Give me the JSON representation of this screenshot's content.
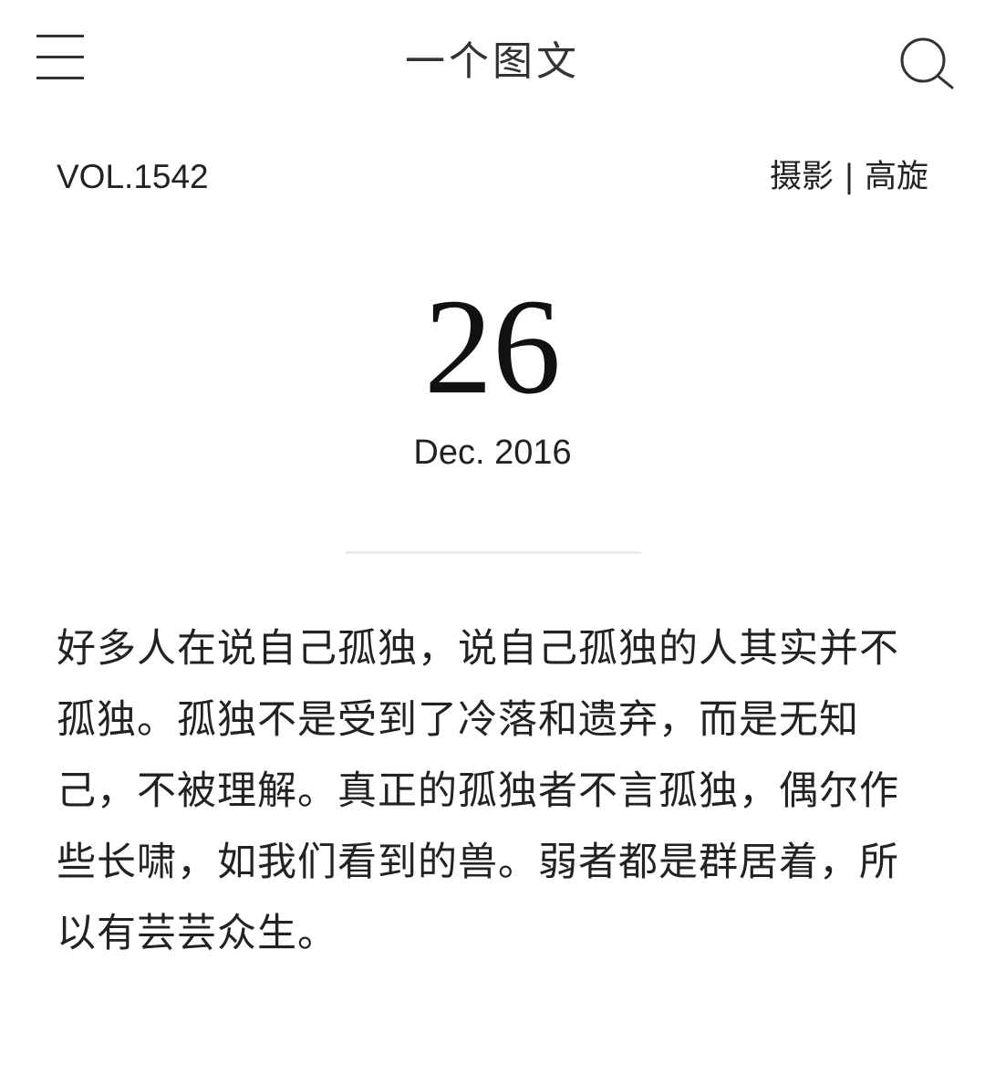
{
  "header": {
    "title": "一个图文",
    "menu_icon": "hamburger-menu-icon",
    "search_icon": "search-icon"
  },
  "meta": {
    "volume": "VOL.1542",
    "credit": "摄影 | 高旋"
  },
  "date": {
    "day": "26",
    "month_year": "Dec. 2016"
  },
  "article": {
    "text": "好多人在说自己孤独，说自己孤独的人其实并不孤独。孤独不是受到了冷落和遗弃，而是无知己，不被理解。真正的孤独者不言孤独，偶尔作些长啸，如我们看到的兽。弱者都是群居着，所以有芸芸众生。"
  },
  "colors": {
    "background": "#ffffff",
    "text": "#222222",
    "divider": "#ececec"
  }
}
